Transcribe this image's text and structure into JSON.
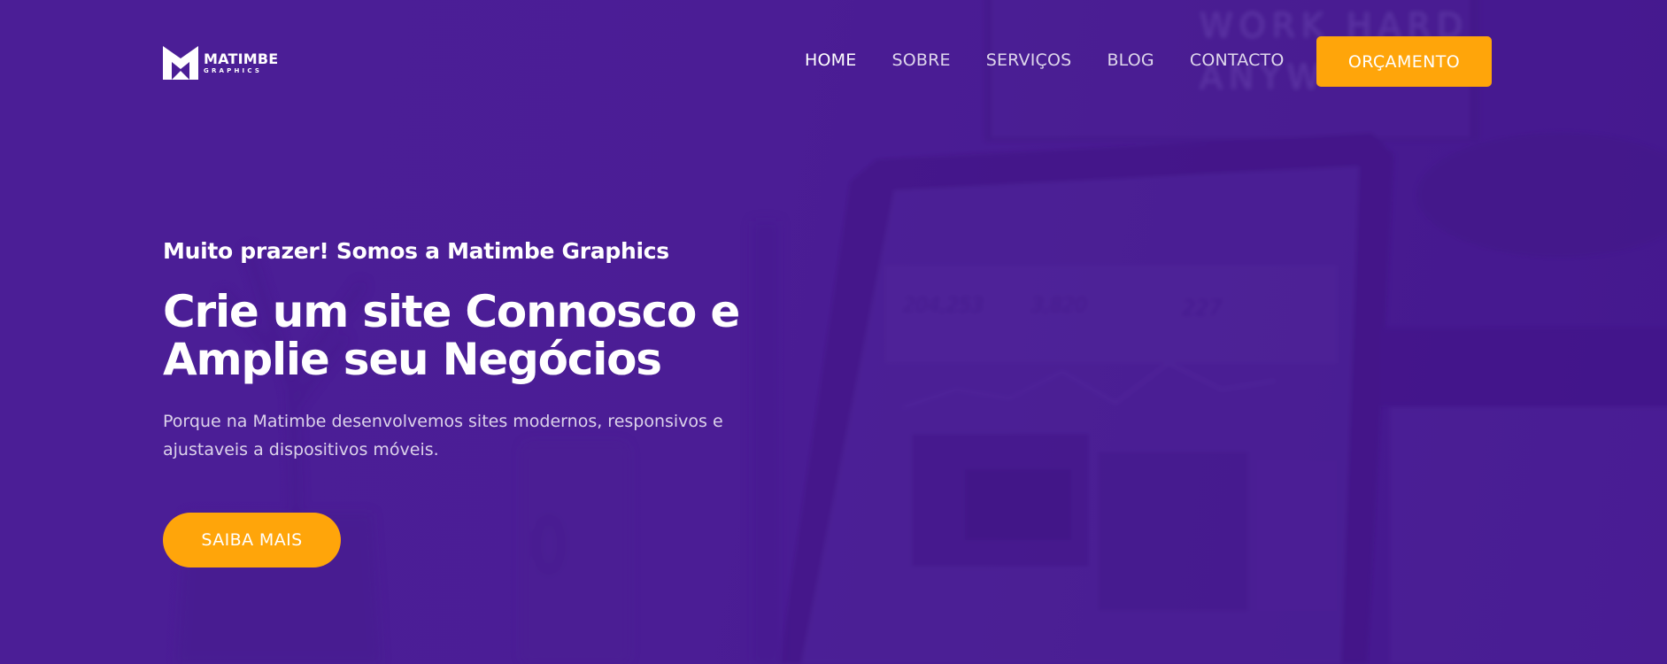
{
  "brand": {
    "name": "MATIMBE",
    "subname": "GRAPHICS",
    "logo_icon": "m-chevron-logo-icon"
  },
  "nav": {
    "items": [
      {
        "label": "HOME",
        "active": true
      },
      {
        "label": "SOBRE",
        "active": false
      },
      {
        "label": "SERVIÇOS",
        "active": false
      },
      {
        "label": "BLOG",
        "active": false
      },
      {
        "label": "CONTACTO",
        "active": false
      }
    ],
    "cta_label": "ORÇAMENTO"
  },
  "hero": {
    "kicker": "Muito prazer! Somos a Matimbe Graphics",
    "headline_line1": "Crie um site Connosco e",
    "headline_line2": "Amplie seu Negócios",
    "description": "Porque na Matimbe desenvolvemos sites modernos, responsivos e ajustaveis a dispositivos móveis.",
    "button_label": "SAIBA MAIS"
  },
  "background": {
    "monitor_text_line1": "WORK HARD",
    "monitor_text_line2": "ANYW",
    "screen_stats": [
      "204,253",
      "3,820",
      "227"
    ]
  },
  "colors": {
    "background": "#4a1e96",
    "accent": "#ffa50a",
    "text": "#ffffff"
  }
}
